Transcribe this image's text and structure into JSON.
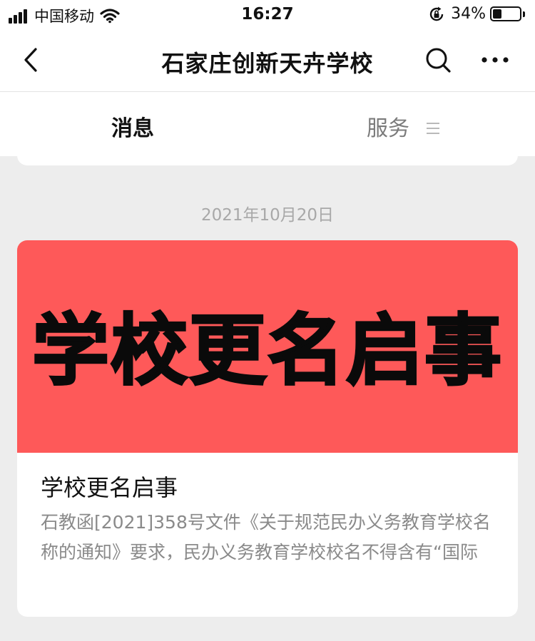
{
  "status_bar": {
    "carrier": "中国移动",
    "time": "16:27",
    "battery_percent_label": "34%",
    "battery_level": 0.34,
    "icons": [
      "signal-icon",
      "wifi-icon",
      "orientation-lock-icon",
      "battery-icon"
    ]
  },
  "nav": {
    "title": "石家庄创新天卉学校",
    "icons": [
      "back-icon",
      "search-icon",
      "more-icon"
    ]
  },
  "tabs": [
    {
      "label": "消息",
      "active": true
    },
    {
      "label": "服务",
      "active": false
    }
  ],
  "feed": {
    "date": "2021年10月20日",
    "article": {
      "cover_text": "学校更名启事",
      "cover_color": "#fe5959",
      "title": "学校更名启事",
      "description": "石教函[2021]358号文件《关于规范民办义务教育学校名称的通知》要求，民办义务教育学校校名不得含有“国际"
    }
  }
}
